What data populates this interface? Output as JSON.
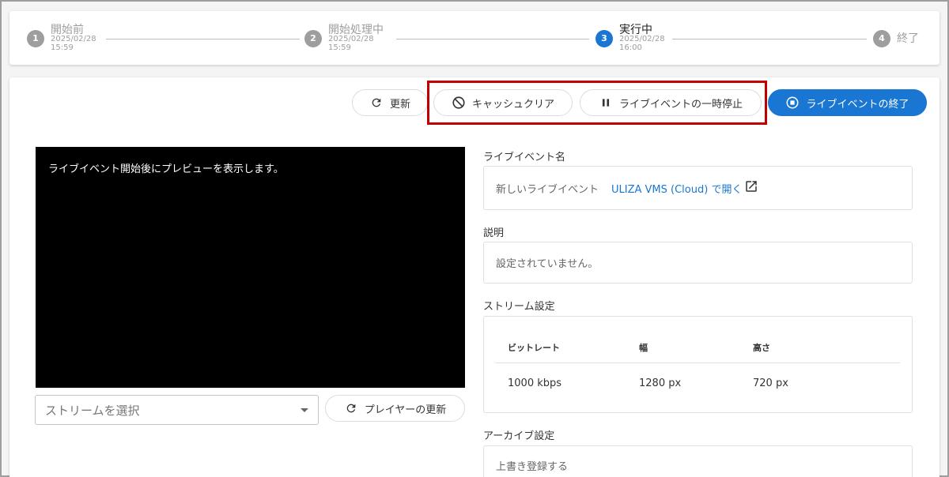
{
  "stepper": {
    "steps": [
      {
        "num": "1",
        "label": "開始前",
        "date": "2025/02/28",
        "time": "15:59"
      },
      {
        "num": "2",
        "label": "開始処理中",
        "date": "2025/02/28",
        "time": "15:59"
      },
      {
        "num": "3",
        "label": "実行中",
        "date": "2025/02/28",
        "time": "16:00"
      },
      {
        "num": "4",
        "label": "終了"
      }
    ]
  },
  "toolbar": {
    "refresh_label": "更新",
    "cache_clear_label": "キャッシュクリア",
    "pause_label": "ライブイベントの一時停止",
    "end_label": "ライブイベントの終了"
  },
  "preview": {
    "message": "ライブイベント開始後にプレビューを表示します。",
    "stream_select_placeholder": "ストリームを選択",
    "player_refresh_label": "プレイヤーの更新"
  },
  "details": {
    "name_label": "ライブイベント名",
    "name_value": "新しいライブイベント",
    "open_link": "ULIZA VMS (Cloud) で開く",
    "description_label": "説明",
    "description_value": "設定されていません。",
    "stream_settings_label": "ストリーム設定",
    "table": {
      "headers": [
        "ビットレート",
        "幅",
        "高さ"
      ],
      "rows": [
        [
          "1000 kbps",
          "1280 px",
          "720 px"
        ]
      ]
    },
    "archive_label": "アーカイブ設定",
    "archive_value": "上書き登録する"
  },
  "colors": {
    "primary": "#1976d2",
    "highlight": "#c00000",
    "inactive": "#9e9e9e"
  }
}
